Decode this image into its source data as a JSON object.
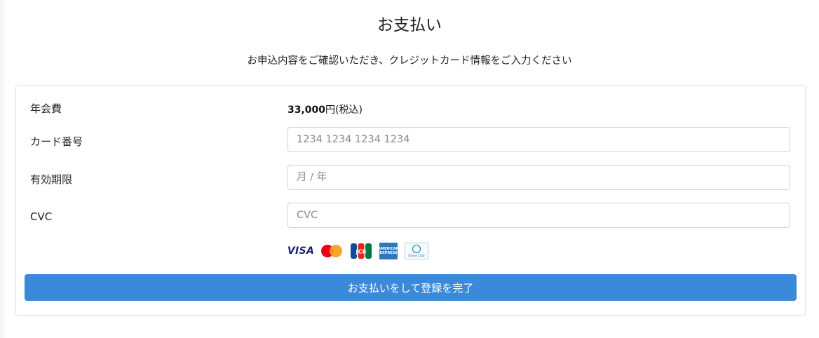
{
  "header": {
    "title": "お支払い",
    "subtitle": "お申込内容をご確認いただき、クレジットカード情報をご入力ください"
  },
  "form": {
    "fee_label": "年会費",
    "fee_amount": "33,000",
    "fee_suffix": "円(税込)",
    "card_number_label": "カード番号",
    "card_number_placeholder": "1234 1234 1234 1234",
    "expiry_label": "有効期限",
    "expiry_placeholder": "月 / 年",
    "cvc_label": "CVC",
    "cvc_placeholder": "CVC"
  },
  "card_brands": [
    {
      "name": "visa-icon",
      "label": "VISA",
      "color": "#1a1f71"
    },
    {
      "name": "mastercard-icon",
      "colors": [
        "#eb001b",
        "#f79e1b"
      ]
    },
    {
      "name": "jcb-icon",
      "label": "JCB",
      "colors": [
        "#0e4c96",
        "#e0251b",
        "#007940"
      ]
    },
    {
      "name": "amex-icon",
      "label": "AMERICAN EXPRESS",
      "color": "#2e77bc"
    },
    {
      "name": "diners-club-icon",
      "label": "Diners Club",
      "color": "#0079be"
    }
  ],
  "submit": {
    "label": "お支払いをして登録を完了",
    "color": "#3b8ad9"
  }
}
